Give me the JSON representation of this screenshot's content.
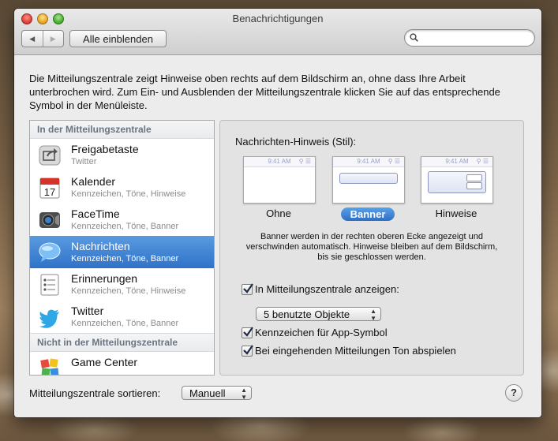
{
  "window": {
    "title": "Benachrichtigungen",
    "show_all": "Alle einblenden",
    "search_placeholder": ""
  },
  "description": "Die Mitteilungszentrale zeigt Hinweise oben rechts auf dem Bildschirm an, ohne dass Ihre Arbeit unterbrochen wird. Zum Ein- und Ausblenden der Mitteilungszentrale klicken Sie auf das entsprechende Symbol in der Menüleiste.",
  "list": {
    "in_header": "In der Mitteilungszentrale",
    "not_in_header": "Nicht in der Mitteilungszentrale",
    "items": [
      {
        "name": "Freigabetaste",
        "sub": "Twitter",
        "icon": "share-icon"
      },
      {
        "name": "Kalender",
        "sub": "Kennzeichen, Töne, Hinweise",
        "icon": "calendar-icon"
      },
      {
        "name": "FaceTime",
        "sub": "Kennzeichen, Töne, Banner",
        "icon": "facetime-icon"
      },
      {
        "name": "Nachrichten",
        "sub": "Kennzeichen, Töne, Banner",
        "icon": "messages-icon"
      },
      {
        "name": "Erinnerungen",
        "sub": "Kennzeichen, Töne, Hinweise",
        "icon": "reminders-icon"
      },
      {
        "name": "Twitter",
        "sub": "Kennzeichen, Töne, Banner",
        "icon": "twitter-icon"
      }
    ],
    "not_in_items": [
      {
        "name": "Game Center",
        "icon": "game-center-icon"
      }
    ],
    "calendar_day": "17"
  },
  "panel": {
    "style_label": "Nachrichten-Hinweis (Stil):",
    "thumb_time": "9:41 AM",
    "styles": [
      "Ohne",
      "Banner",
      "Hinweise"
    ],
    "selected_style": "Banner",
    "style_desc": "Banner werden in der rechten oberen Ecke angezeigt und verschwinden automatisch. Hinweise bleiben auf dem Bildschirm, bis sie geschlossen werden.",
    "show_in_center": "In Mitteilungszentrale anzeigen:",
    "show_in_center_checked": true,
    "items_popup": "5 benutzte Objekte",
    "badge_label": "Kennzeichen für App-Symbol",
    "badge_checked": true,
    "sound_label": "Bei eingehenden Mitteilungen Ton abspielen",
    "sound_checked": true
  },
  "footer": {
    "sort_label": "Mitteilungszentrale sortieren:",
    "sort_value": "Manuell",
    "help": "?"
  }
}
